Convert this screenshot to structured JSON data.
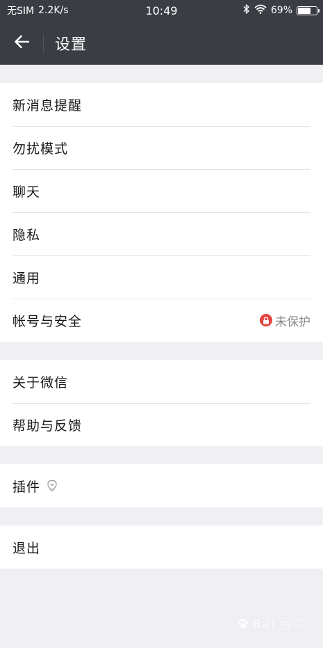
{
  "status_bar": {
    "carrier": "无SIM",
    "speed": "2.2K/s",
    "time": "10:49",
    "battery_text": "69%",
    "battery_level": 0.69,
    "icons": [
      "bluetooth-icon",
      "wifi-icon",
      "battery-icon"
    ]
  },
  "header": {
    "title": "设置",
    "back_icon": "arrow-left-icon"
  },
  "groups": [
    {
      "items": [
        {
          "label": "新消息提醒"
        },
        {
          "label": "勿扰模式"
        },
        {
          "label": "聊天"
        },
        {
          "label": "隐私"
        },
        {
          "label": "通用"
        },
        {
          "label": "帐号与安全",
          "status": "未保护",
          "status_icon": "lock-icon",
          "status_color": "#e64340"
        }
      ]
    },
    {
      "items": [
        {
          "label": "关于微信"
        },
        {
          "label": "帮助与反馈"
        }
      ]
    },
    {
      "items": [
        {
          "label": "插件",
          "icon": "lightbulb-icon"
        }
      ]
    },
    {
      "items": [
        {
          "label": "退出"
        }
      ]
    }
  ],
  "watermark": {
    "text": "Bai 经验"
  },
  "colors": {
    "header_bg": "#3a3d44",
    "page_bg": "#efeff4",
    "row_bg": "#ffffff",
    "lock_red": "#e64340"
  }
}
